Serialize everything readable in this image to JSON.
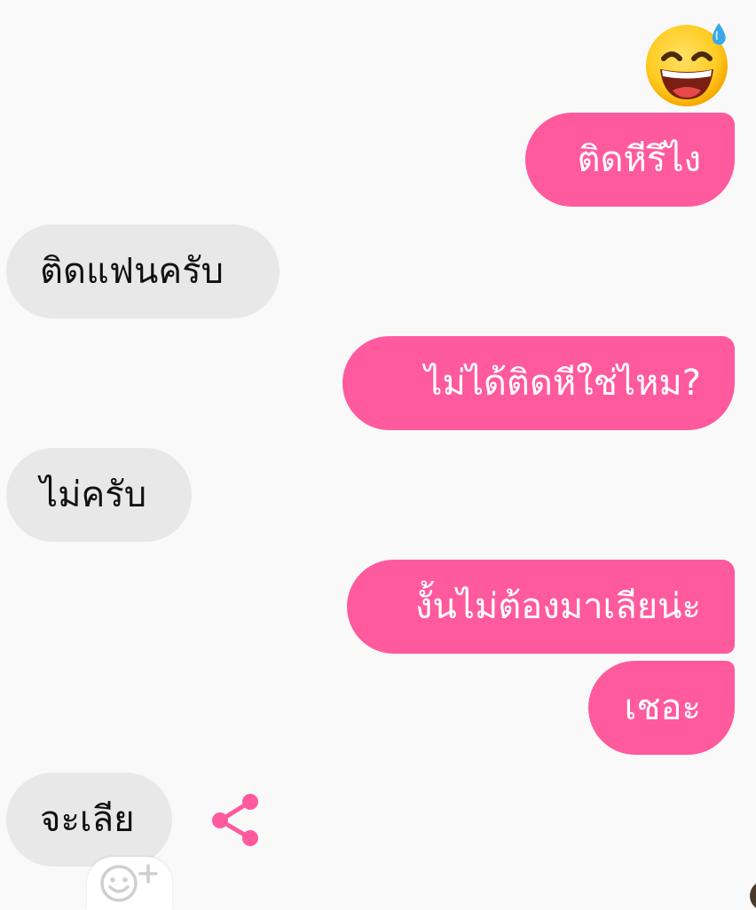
{
  "conversation": {
    "messages": [
      {
        "side": "sent",
        "text": "ติดหีรึไง"
      },
      {
        "side": "received",
        "text": "ติดแฟนครับ"
      },
      {
        "side": "sent",
        "text": "ไม่ได้ติดหีใช่ไหม?"
      },
      {
        "side": "received",
        "text": "ไม่ครับ"
      },
      {
        "side": "sent",
        "text": "งั้นไม่ต้องมาเลียน่ะ"
      },
      {
        "side": "sent",
        "text": "เชอะ"
      },
      {
        "side": "received",
        "text": "จะเลีย"
      }
    ],
    "top_emoji": "grinning-sweat-emoji"
  },
  "icons": {
    "share": "share-icon",
    "add_reaction": "add-reaction-icon"
  },
  "colors": {
    "sent_bubble": "#ff5a9e",
    "received_bubble": "#e8e8e8",
    "background": "#f9f9f9",
    "accent": "#ff5a9e"
  }
}
